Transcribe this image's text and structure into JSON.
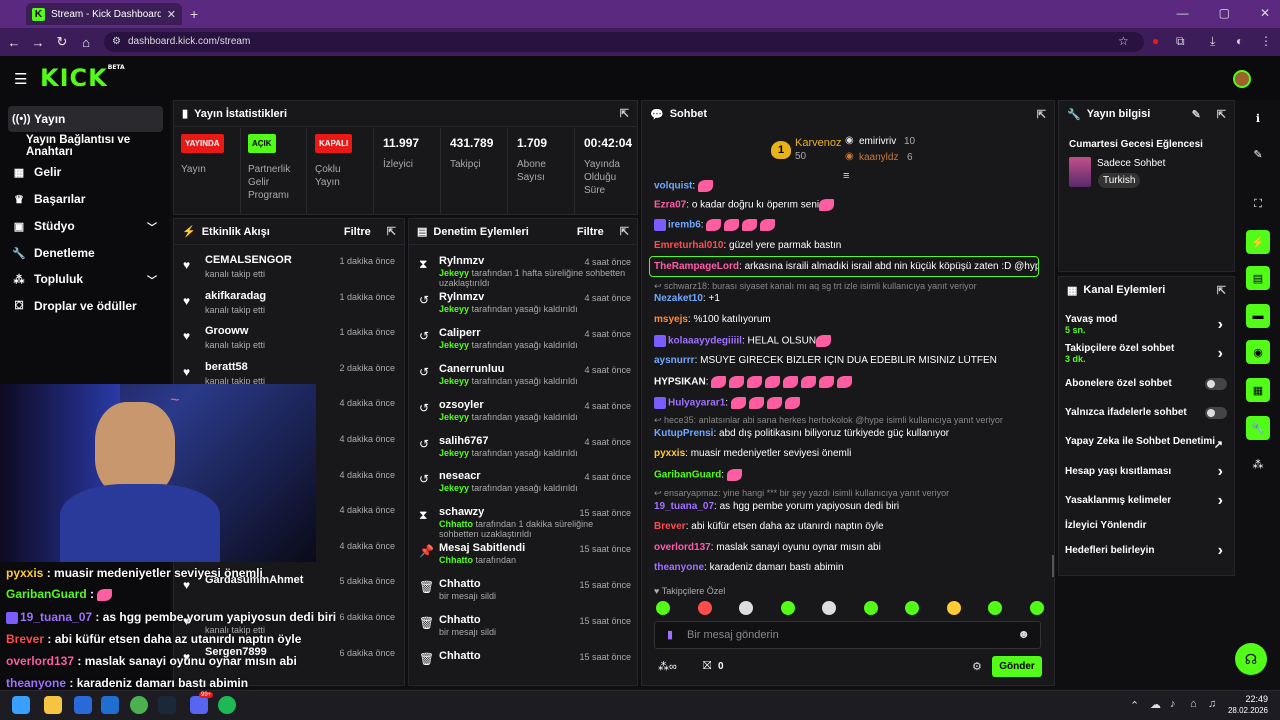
{
  "browser": {
    "tab_title": "Stream - Kick Dashboard",
    "tab_icon": "K",
    "url": "dashboard.kick.com/stream"
  },
  "header": {
    "logo": "KICK",
    "logo_tag": "BETA"
  },
  "sidebar": {
    "items": [
      {
        "label": "Yayın",
        "icon": "broadcast-icon"
      },
      {
        "label": "Yayın Bağlantısı ve Anahtarı"
      },
      {
        "label": "Gelir",
        "icon": "revenue-icon"
      },
      {
        "label": "Başarılar",
        "icon": "trophy-icon"
      },
      {
        "label": "Stüdyo",
        "icon": "studio-icon"
      },
      {
        "label": "Denetleme",
        "icon": "wrench-icon"
      },
      {
        "label": "Topluluk",
        "icon": "community-icon"
      },
      {
        "label": "Droplar ve ödüller",
        "icon": "drops-icon"
      }
    ]
  },
  "stats": {
    "title": "Yayın İstatistikleri",
    "items": [
      {
        "badge": "YAYINDA",
        "label": "Yayın",
        "color": "#e91916"
      },
      {
        "badge": "AÇIK",
        "label": "Partnerlik Gelir Programı",
        "color": "#53fc18"
      },
      {
        "badge": "KAPALI",
        "label": "Çoklu Yayın",
        "color": "#e91916"
      },
      {
        "num": "11.997",
        "label": "İzleyici"
      },
      {
        "num": "431.789",
        "label": "Takipçi"
      },
      {
        "num": "1.709",
        "label": "Abone Sayısı"
      },
      {
        "num": "00:42:04",
        "label": "Yayında Olduğu Süre"
      }
    ]
  },
  "activity": {
    "title": "Etkinlik Akışı",
    "filter": "Filtre",
    "rows": [
      {
        "name": "CEMALSENGOR",
        "sub": "kanalı takip etti",
        "time": "1 dakika önce"
      },
      {
        "name": "akifkaradag",
        "sub": "kanalı takip etti",
        "time": "1 dakika önce"
      },
      {
        "name": "Grooww",
        "sub": "kanalı takip etti",
        "time": "1 dakika önce"
      },
      {
        "name": "beratt58",
        "sub": "kanalı takip etti",
        "time": "2 dakika önce"
      },
      {
        "name": "",
        "sub": "",
        "time": "4 dakika önce"
      },
      {
        "name": "",
        "sub": "",
        "time": "4 dakika önce"
      },
      {
        "name": "",
        "sub": "",
        "time": "4 dakika önce"
      },
      {
        "name": "",
        "sub": "",
        "time": "4 dakika önce"
      },
      {
        "name": "",
        "sub": "",
        "time": "4 dakika önce"
      },
      {
        "name": "GardasummAhmet",
        "sub": "",
        "time": "5 dakika önce"
      },
      {
        "name": "",
        "sub": "kanalı takip etti",
        "time": "6 dakika önce"
      },
      {
        "name": "Sergen7899",
        "sub": "",
        "time": "6 dakika önce"
      }
    ]
  },
  "moderation": {
    "title": "Denetim Eylemleri",
    "filter": "Filtre",
    "rows": [
      {
        "name": "Rylnmzv",
        "by": "Jekeyy",
        "text": "tarafından 1 hafta süreliğine sohbetten uzaklaştırıldı",
        "time": "4 saat önce",
        "icon": "⧗"
      },
      {
        "name": "Rylnmzv",
        "by": "Jekeyy",
        "text": "tarafından yasağı kaldırıldı",
        "time": "4 saat önce",
        "icon": "↺"
      },
      {
        "name": "Caliperr",
        "by": "Jekeyy",
        "text": "tarafından yasağı kaldırıldı",
        "time": "4 saat önce",
        "icon": "↺"
      },
      {
        "name": "Canerrunluu",
        "by": "Jekeyy",
        "text": "tarafından yasağı kaldırıldı",
        "time": "4 saat önce",
        "icon": "↺"
      },
      {
        "name": "ozsoyler",
        "by": "Jekeyy",
        "text": "tarafından yasağı kaldırıldı",
        "time": "4 saat önce",
        "icon": "↺"
      },
      {
        "name": "salih6767",
        "by": "Jekeyy",
        "text": "tarafından yasağı kaldırıldı",
        "time": "4 saat önce",
        "icon": "↺"
      },
      {
        "name": "neseacr",
        "by": "Jekeyy",
        "text": "tarafından yasağı kaldırıldı",
        "time": "4 saat önce",
        "icon": "↺"
      },
      {
        "name": "schawzy",
        "by": "Chhatto",
        "text": "tarafından 1 dakika süreliğine sohbetten uzaklaştırıldı",
        "time": "15 saat önce",
        "icon": "⧗"
      },
      {
        "name": "Mesaj Sabitlendi",
        "by": "Chhatto",
        "text": "tarafından",
        "time": "15 saat önce",
        "icon": "📌"
      },
      {
        "name": "Chhatto",
        "by": "",
        "text": "bir mesajı sildi",
        "time": "15 saat önce",
        "icon": "🗑"
      },
      {
        "name": "Chhatto",
        "by": "",
        "text": "bir mesajı sildi",
        "time": "15 saat önce",
        "icon": "🗑"
      },
      {
        "name": "Chhatto",
        "by": "",
        "text": "",
        "time": "15 saat önce",
        "icon": "🗑"
      }
    ]
  },
  "chat": {
    "title": "Sohbet",
    "leaders": [
      {
        "name": "Karvenoz",
        "value": "50"
      },
      {
        "name": "emirivriv",
        "value": "10"
      },
      {
        "name": "kaanyldz",
        "value": "6"
      }
    ],
    "messages": [
      {
        "user": "volquist",
        "color": "#6fa8ff",
        "text": ""
      },
      {
        "user": "Ezra07",
        "color": "#ff5ca8",
        "text": "o kadar doğru kı öperım seni"
      },
      {
        "user": "iremb6",
        "color": "#6fa8ff",
        "text": ""
      },
      {
        "user": "Emreturhal010",
        "color": "#ff4d4d",
        "text": "güzel yere parmak bastın"
      },
      {
        "user": "TheRampageLord",
        "color": "#ff5ca8",
        "text": "arkasına israili almadıki israil abd nin küçük köpüşü zaten :D @hype"
      },
      {
        "reply": "schwarz18: burası siyaset kanalı mı aq sg trt izle isimli kullanıcıya yanıt veriyor"
      },
      {
        "user": "Nezaket10",
        "color": "#6fa8ff",
        "text": "+1"
      },
      {
        "user": "msyejs",
        "color": "#ff8c3a",
        "text": "%100 katılıyorum"
      },
      {
        "user": "kolaaayydegiiiil",
        "color": "#a070ff",
        "text": "HELAL OLSUN"
      },
      {
        "user": "aysnurrr",
        "color": "#6fa8ff",
        "text": "MSÜYE GİRECEK BİZLER İÇİN DUA EDEBİLİR MİSİNİZ LÜTFEN"
      },
      {
        "user": "HYPSIKAN",
        "color": "#ffffff",
        "text": ""
      },
      {
        "user": "Hulyayarar1",
        "color": "#a070ff",
        "text": ""
      },
      {
        "reply": "hece35: anlatsınlar abi sana herkes herbokolok @hype isimli kullanıcıya yanıt veriyor"
      },
      {
        "user": "KutupPrensi",
        "color": "#6fa8ff",
        "text": "abd dış politikasını biliyoruz türkiyede güç kullanıyor"
      },
      {
        "user": "pyxxis",
        "color": "#ffcc33",
        "text": "muasir medeniyetler seviyesi önemli"
      },
      {
        "user": "GaribanGuard",
        "color": "#53fc18",
        "text": ""
      },
      {
        "reply": "ensaryapmaz: yine hangi *** bir şey yazdı isimli kullanıcıya yanıt veriyor"
      },
      {
        "user": "19_tuana_07",
        "color": "#a070ff",
        "text": "as hgg pembe yorum yapiyosun dedi biri"
      },
      {
        "user": "Brever",
        "color": "#ff4d4d",
        "text": "abi küfür etsen daha az utanırdı naptın öyle"
      },
      {
        "user": "overlord137",
        "color": "#ff5ca8",
        "text": "maslak sanayi oyunu oynar mısın abi"
      },
      {
        "user": "theanyone",
        "color": "#a070ff",
        "text": "karadeniz damarı bastı abimin"
      }
    ],
    "followers_only": "Takipçilere Özel",
    "input_placeholder": "Bir mesaj gönderin",
    "points": "0",
    "send": "Gönder"
  },
  "stream_info": {
    "title": "Yayın bilgisi",
    "stream_title": "Cumartesi Gecesi Eğlencesi",
    "category": "Sadece Sohbet",
    "tag": "Turkish"
  },
  "channel_actions": {
    "title": "Kanal Eylemleri",
    "rows": [
      {
        "label": "Yavaş mod",
        "sub": "5 sn.",
        "type": "chev"
      },
      {
        "label": "Takipçilere özel sohbet",
        "sub": "3 dk.",
        "type": "chev"
      },
      {
        "label": "Abonelere özel sohbet",
        "type": "toggle"
      },
      {
        "label": "Yalnızca ifadelerle sohbet",
        "type": "toggle"
      },
      {
        "label": "Yapay Zeka ile Sohbet Denetimi",
        "type": "link"
      },
      {
        "label": "Hesap yaşı kısıtlaması",
        "type": "chev"
      },
      {
        "label": "Yasaklanmış kelimeler",
        "type": "chev"
      },
      {
        "label": "İzleyici Yönlendir",
        "type": "none"
      },
      {
        "label": "Hedefleri belirleyin",
        "type": "chev"
      }
    ]
  },
  "overlay_chat": [
    {
      "user": "pyxxis",
      "color": "#ffcc33",
      "text": "muasir medeniyetler seviyesi önemli"
    },
    {
      "user": "GaribanGuard",
      "color": "#53fc18",
      "text": ""
    },
    {
      "user": "19_tuana_07",
      "color": "#a070ff",
      "text": "as hgg pembe yorum yapiyosun dedi biri"
    },
    {
      "user": "Brever",
      "color": "#ff4d4d",
      "text": "abi küfür etsen daha az utanırdı naptın öyle"
    },
    {
      "user": "overlord137",
      "color": "#ff5ca8",
      "text": "maslak sanayi oyunu oynar mısın abi"
    },
    {
      "user": "theanyone",
      "color": "#a070ff",
      "text": "karadeniz damarı bastı abimin"
    }
  ],
  "taskbar": {
    "time": "22:49",
    "date": "28.02.2026",
    "badge": "99+"
  },
  "colors": {
    "accent": "#53fc18",
    "live": "#e91916"
  }
}
